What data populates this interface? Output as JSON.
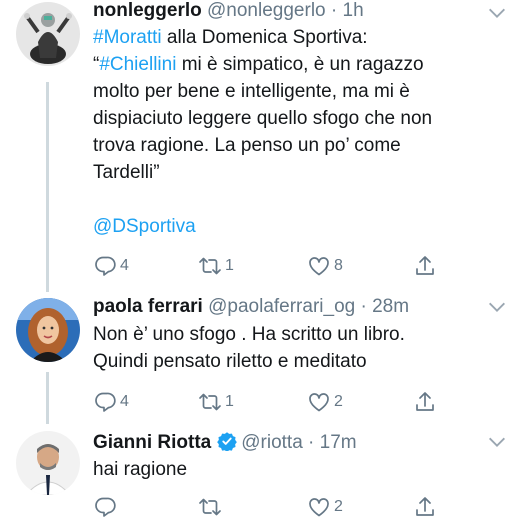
{
  "tweets": [
    {
      "name": "nonleggerlo",
      "handle": "@nonleggerlo",
      "time": "· 1h",
      "body": [
        [
          {
            "t": "#Moratti",
            "link": true
          },
          {
            "t": " alla Domenica Sportiva:"
          }
        ],
        [
          {
            "t": "“"
          },
          {
            "t": "#Chiellini",
            "link": true
          },
          {
            "t": " mi è simpatico, è un ragazzo"
          }
        ],
        [
          {
            "t": "molto per bene e intelligente, ma mi è"
          }
        ],
        [
          {
            "t": "dispiaciuto leggere quello sfogo che non"
          }
        ],
        [
          {
            "t": "trova ragione. La penso un po’ come"
          }
        ],
        [
          {
            "t": "Tardelli”"
          }
        ],
        [
          {
            "t": ""
          }
        ],
        [
          {
            "t": "@DSportiva",
            "link": true
          }
        ]
      ],
      "replies": "4",
      "retweets": "1",
      "likes": "8"
    },
    {
      "name": "paola ferrari",
      "handle": "@paolaferrari_og",
      "time": "· 28m",
      "body": [
        [
          {
            "t": "Non è’ uno sfogo . Ha scritto un libro."
          }
        ],
        [
          {
            "t": "Quindi pensato riletto e meditato"
          }
        ]
      ],
      "replies": "4",
      "retweets": "1",
      "likes": "2"
    },
    {
      "name": "Gianni Riotta",
      "verified": true,
      "handle": "@riotta",
      "time": "· 17m",
      "body": [
        [
          {
            "t": "hai ragione"
          }
        ]
      ],
      "replies": "",
      "retweets": "",
      "likes": "2"
    }
  ],
  "icons": {
    "reply": "reply-icon",
    "retweet": "retweet-icon",
    "like": "heart-icon",
    "share": "share-icon",
    "caret": "chevron-down-icon",
    "verified": "verified-badge-icon"
  },
  "colors": {
    "link": "#1da1f2",
    "secondary": "#657786",
    "thread_line": "#cfd9de",
    "verified": "#1da1f2"
  }
}
